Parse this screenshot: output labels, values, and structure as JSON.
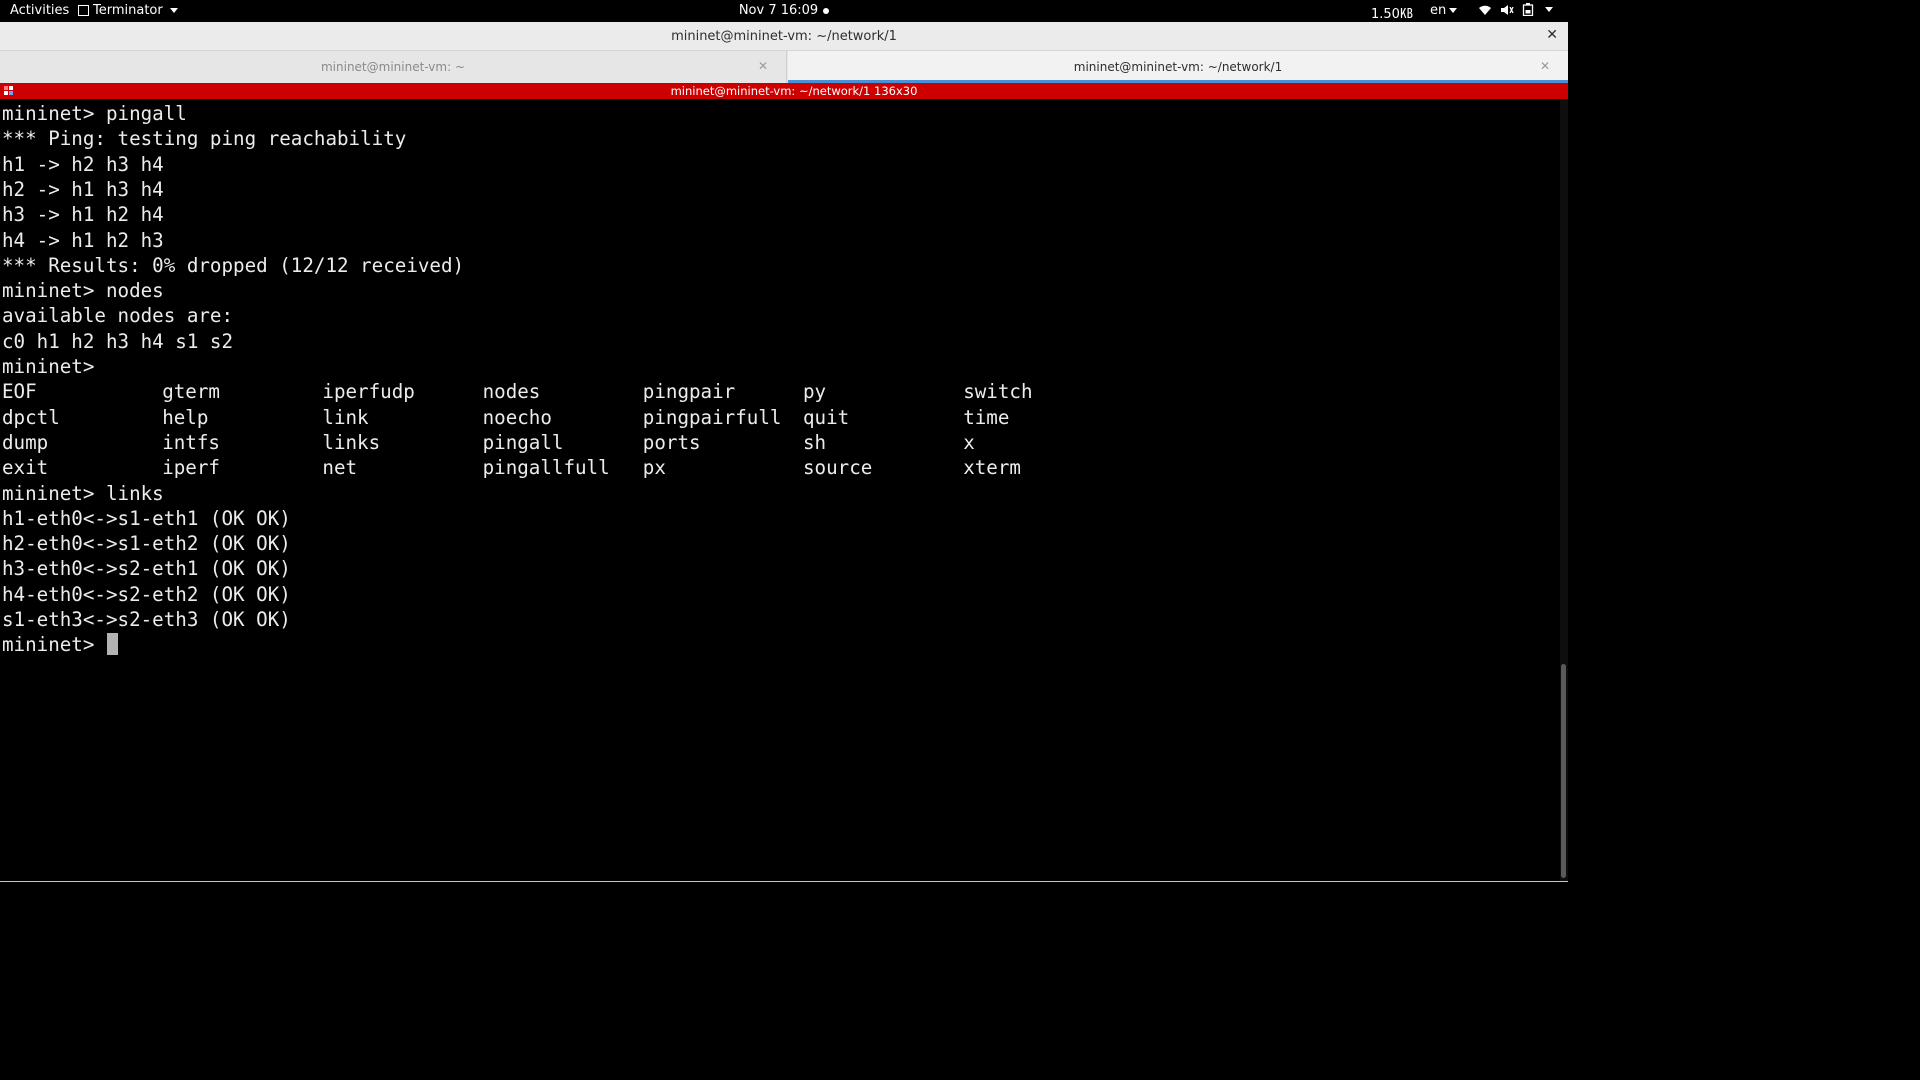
{
  "topbar": {
    "activities": "Activities",
    "app_name": "Terminator",
    "clock": "Nov 7  16:09",
    "netspeed": "1.50㎅",
    "language": "en"
  },
  "window": {
    "title": "mininet@mininet-vm: ~/network/1",
    "close_glyph": "✕"
  },
  "tabs": [
    {
      "label": "mininet@mininet-vm: ~",
      "close_glyph": "✕",
      "active": false
    },
    {
      "label": "mininet@mininet-vm: ~/network/1",
      "close_glyph": "✕",
      "active": true
    }
  ],
  "terminal": {
    "title": "mininet@mininet-vm: ~/network/1 136x30",
    "title_bg": "#cc0000",
    "lines": [
      "mininet> pingall",
      "*** Ping: testing ping reachability",
      "h1 -> h2 h3 h4",
      "h2 -> h1 h3 h4",
      "h3 -> h1 h2 h4",
      "h4 -> h1 h2 h3",
      "*** Results: 0% dropped (12/12 received)",
      "mininet> nodes",
      "available nodes are:",
      "c0 h1 h2 h3 h4 s1 s2",
      "mininet>"
    ],
    "command_table": [
      [
        "EOF",
        "gterm",
        "iperfudp",
        "nodes",
        "pingpair",
        "py",
        "switch"
      ],
      [
        "dpctl",
        "help",
        "link",
        "noecho",
        "pingpairfull",
        "quit",
        "time"
      ],
      [
        "dump",
        "intfs",
        "links",
        "pingall",
        "ports",
        "sh",
        "x"
      ],
      [
        "exit",
        "iperf",
        "net",
        "pingallfull",
        "px",
        "source",
        "xterm"
      ]
    ],
    "lines_after": [
      "mininet> links",
      "h1-eth0<->s1-eth1 (OK OK)",
      "h2-eth0<->s1-eth2 (OK OK)",
      "h3-eth0<->s2-eth1 (OK OK)",
      "h4-eth0<->s2-eth2 (OK OK)",
      "s1-eth3<->s2-eth3 (OK OK)"
    ],
    "prompt": "mininet> "
  },
  "icons": {
    "app_icon": "terminal-icon",
    "wifi": "wifi-icon",
    "volume": "volume-icon",
    "battery": "battery-icon",
    "grip": "terminator-grip-icon"
  }
}
